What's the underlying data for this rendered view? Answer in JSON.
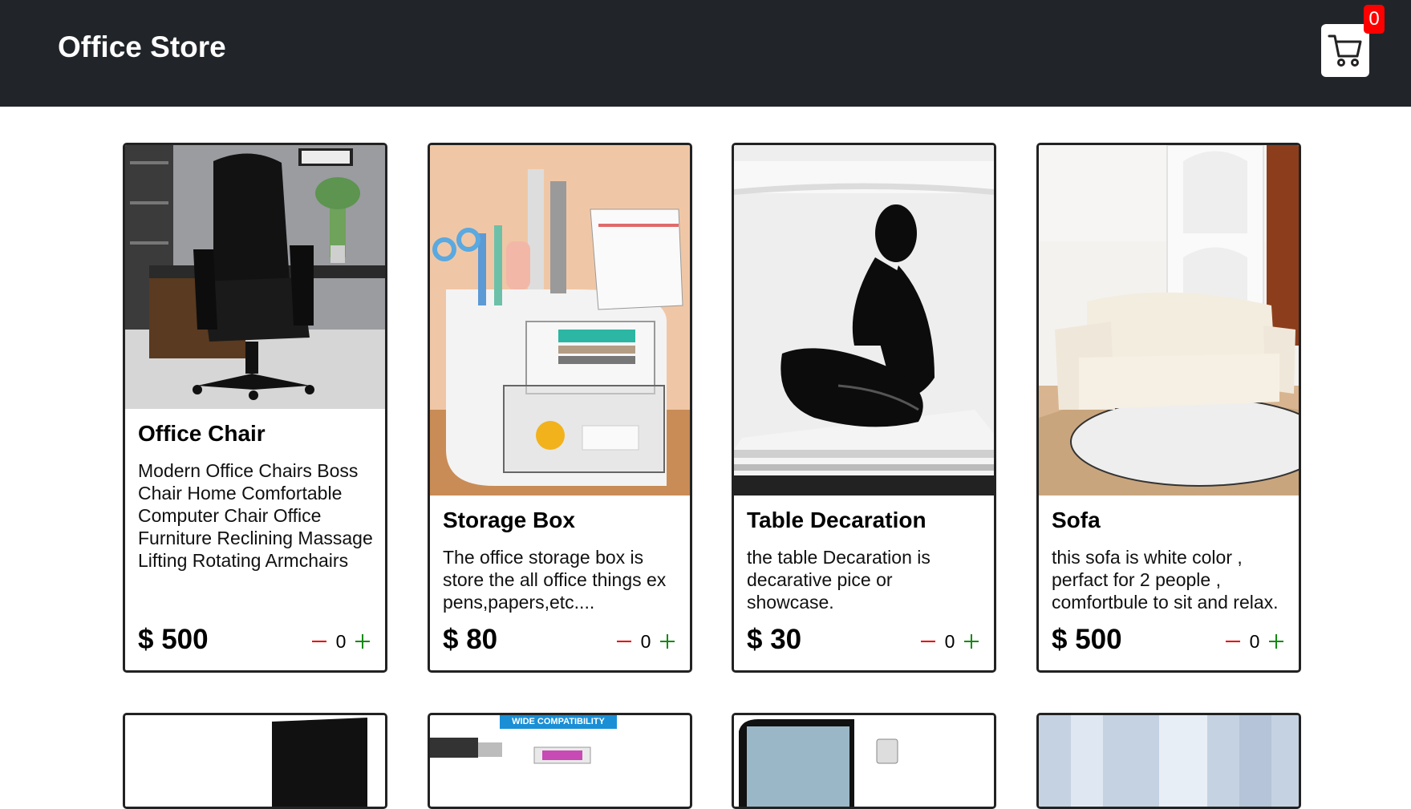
{
  "header": {
    "brand": "Office Store",
    "cart_icon": "shopping-cart-icon",
    "cart_count": "0",
    "background": "#212529"
  },
  "products": [
    {
      "title": "Office Chair",
      "description": "Modern Office Chairs Boss Chair Home Comfortable Computer Chair Office Furniture Reclining Massage Lifting Rotating Armchairs",
      "price": "$ 500",
      "quantity": "0"
    },
    {
      "title": "Storage Box",
      "description": "The office storage box is store the all office things ex pens,papers,etc....",
      "price": "$ 80",
      "quantity": "0"
    },
    {
      "title": "Table Decaration",
      "description": "the table Decaration is decarative pice or showcase.",
      "price": "$ 30",
      "quantity": "0"
    },
    {
      "title": "Sofa",
      "description": "this sofa is white color , perfact for 2 people , comfortbule to sit and relax.",
      "price": "$ 500",
      "quantity": "0"
    }
  ],
  "row2": {
    "badge_text": "WIDE COMPATIBILITY"
  },
  "colors": {
    "minus": "#e30000",
    "plus": "#118a11",
    "badge": "#ff0000"
  }
}
